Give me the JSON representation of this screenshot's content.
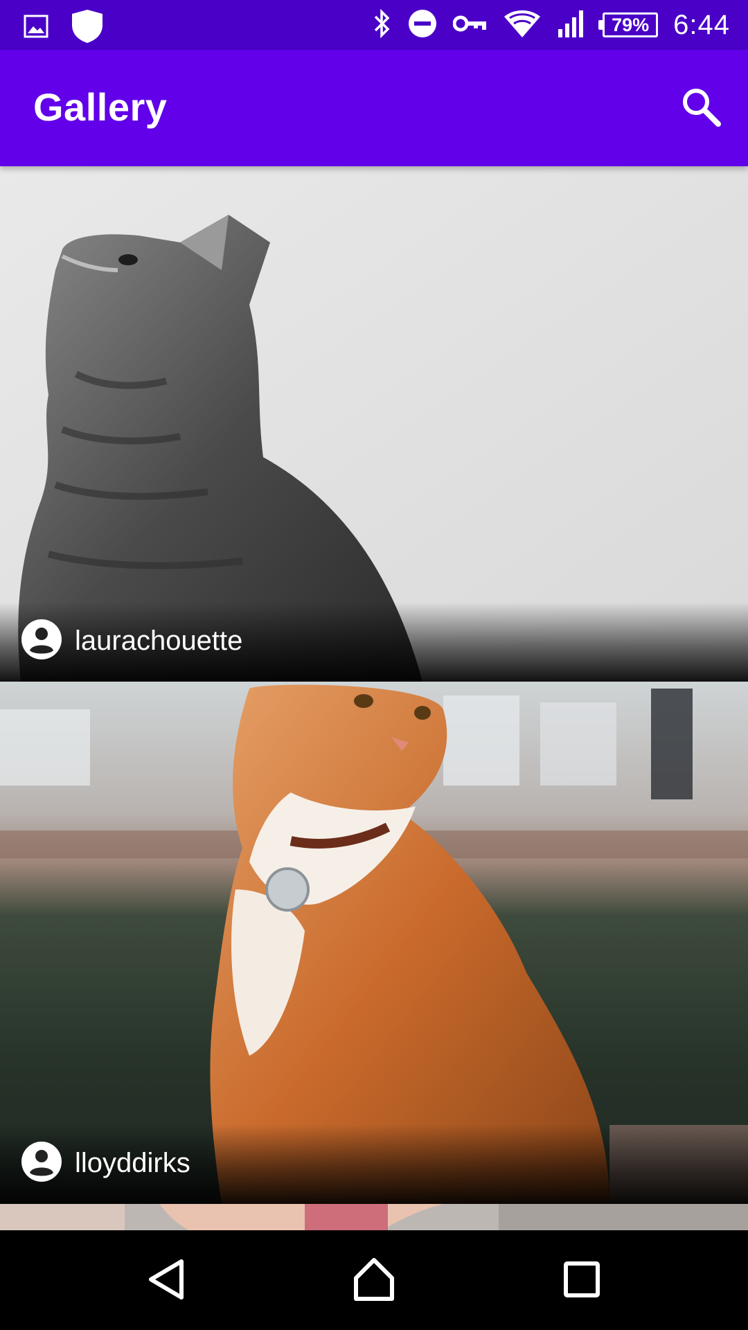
{
  "status_bar": {
    "time": "6:44",
    "battery_percent": "79%",
    "icons": [
      "image-icon",
      "shield-icon",
      "bluetooth-icon",
      "do-not-disturb-icon",
      "vpn-key-icon",
      "wifi-icon",
      "cell-signal-icon",
      "battery-icon"
    ]
  },
  "app_bar": {
    "title": "Gallery",
    "search_icon": "search-icon",
    "color": "#6200ea",
    "status_color": "#4a00c7"
  },
  "gallery": {
    "items": [
      {
        "author": "laurachouette",
        "avatar_icon": "account-circle-icon"
      },
      {
        "author": "lloyddirks",
        "avatar_icon": "account-circle-icon"
      }
    ]
  },
  "nav_bar": {
    "icons": [
      "back-icon",
      "home-icon",
      "recents-icon"
    ]
  }
}
